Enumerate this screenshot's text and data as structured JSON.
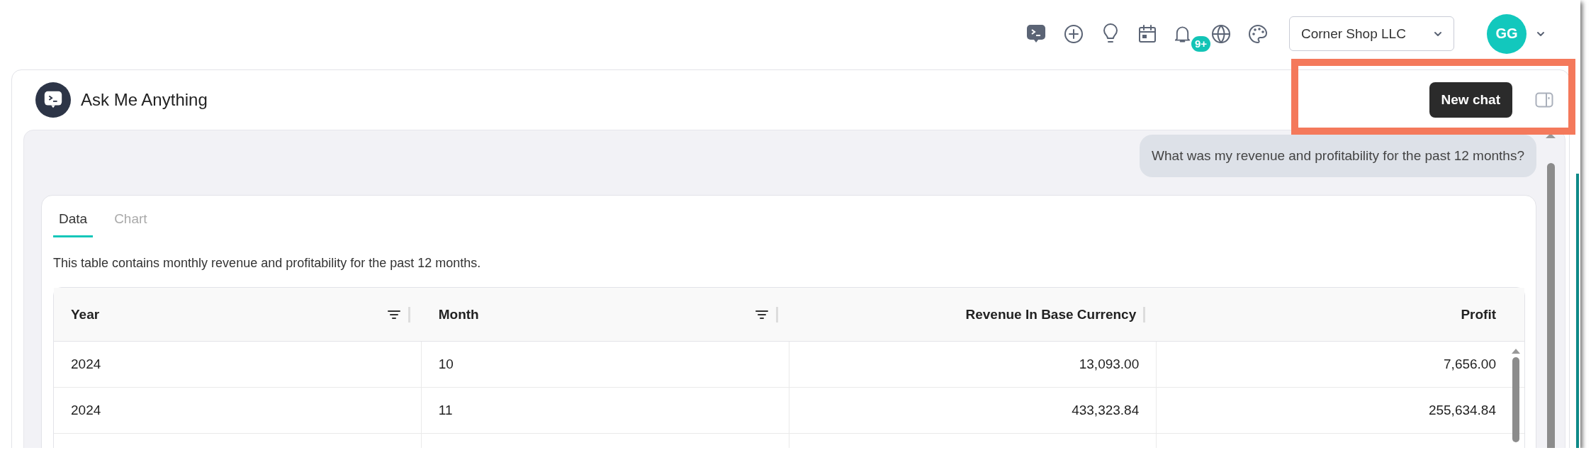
{
  "topbar": {
    "notification_badge": "9+",
    "company_select": {
      "value": "Corner Shop LLC"
    },
    "avatar": {
      "initials": "GG"
    }
  },
  "panel": {
    "title": "Ask Me Anything",
    "new_chat_button": "New chat",
    "messages": [
      {
        "text": "What was my revenue and profitability for the past 12 months?"
      }
    ],
    "result": {
      "tabs": [
        {
          "label": "Data",
          "selected": true
        },
        {
          "label": "Chart",
          "selected": false
        }
      ],
      "description": "This table contains monthly revenue and profitability for the past 12 months.",
      "table": {
        "columns": [
          {
            "label": "Year",
            "kind": "text",
            "filterable": true
          },
          {
            "label": "Month",
            "kind": "text",
            "filterable": true
          },
          {
            "label": "Revenue In Base Currency",
            "kind": "amount",
            "filterable": false
          },
          {
            "label": "Profit",
            "kind": "amount",
            "filterable": false
          }
        ],
        "rows": [
          [
            "2024",
            "10",
            "13,093.00",
            "7,656.00"
          ],
          [
            "2024",
            "11",
            "433,323.84",
            "255,634.84"
          ]
        ]
      }
    }
  }
}
